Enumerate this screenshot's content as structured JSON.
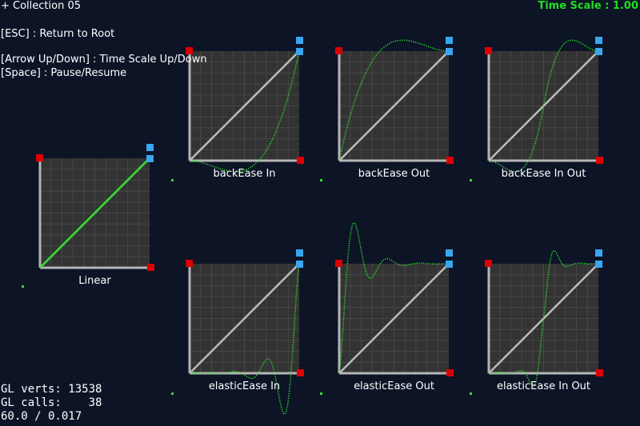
{
  "header": {
    "title": "+ Collection 05",
    "time_scale": "Time Scale : 1.00",
    "time_scale_color": "#22dd22"
  },
  "help": {
    "esc": "[ESC] : Return to Root",
    "arrows": "[Arrow Up/Down] : Time Scale Up/Down",
    "space": "[Space] : Pause/Resume"
  },
  "stats": {
    "verts": "GL verts: 13538",
    "calls": "GL calls:    38",
    "fps": "60.0 / 0.017"
  },
  "colors": {
    "background": "#0c1426",
    "panel": "#333333",
    "grid": "#474747",
    "axis": "#b4b4b4",
    "diagonal": "#bcbcbc",
    "curve": "#2fdd2f",
    "start_marker": "#dd0000",
    "end_marker": "#3aa6f0"
  },
  "graphs": [
    {
      "id": "linear",
      "label": "Linear",
      "ease": "linear"
    },
    {
      "id": "back-in",
      "label": "backEase In",
      "ease": "backIn"
    },
    {
      "id": "back-out",
      "label": "backEase Out",
      "ease": "backOut"
    },
    {
      "id": "back-inout",
      "label": "backEase In Out",
      "ease": "backInOut"
    },
    {
      "id": "elastic-in",
      "label": "elasticEase In",
      "ease": "elasticIn"
    },
    {
      "id": "elastic-out",
      "label": "elasticEase Out",
      "ease": "elasticOut"
    },
    {
      "id": "elastic-inout",
      "label": "elasticEase In Out",
      "ease": "elasticInOut"
    }
  ]
}
